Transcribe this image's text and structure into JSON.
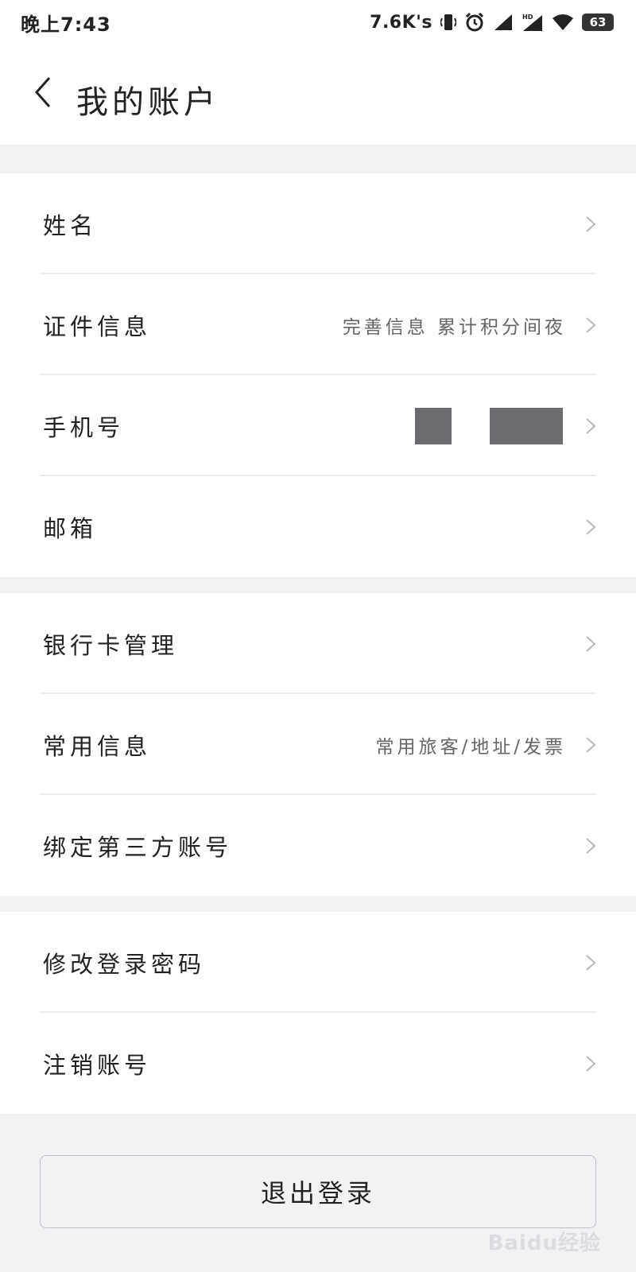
{
  "status_bar": {
    "time": "晚上7:43",
    "net_speed": "7.6K's",
    "battery": "63"
  },
  "header": {
    "title": "我的账户"
  },
  "groups": [
    {
      "rows": [
        {
          "label": "姓名",
          "value": ""
        },
        {
          "label": "证件信息",
          "value": "完善信息 累计积分间夜"
        },
        {
          "label": "手机号",
          "value": ""
        },
        {
          "label": "邮箱",
          "value": ""
        }
      ]
    },
    {
      "rows": [
        {
          "label": "银行卡管理",
          "value": ""
        },
        {
          "label": "常用信息",
          "value": "常用旅客/地址/发票"
        },
        {
          "label": "绑定第三方账号",
          "value": ""
        }
      ]
    },
    {
      "rows": [
        {
          "label": "修改登录密码",
          "value": ""
        },
        {
          "label": "注销账号",
          "value": ""
        }
      ]
    }
  ],
  "logout_label": "退出登录",
  "watermark": "Baidu经验"
}
